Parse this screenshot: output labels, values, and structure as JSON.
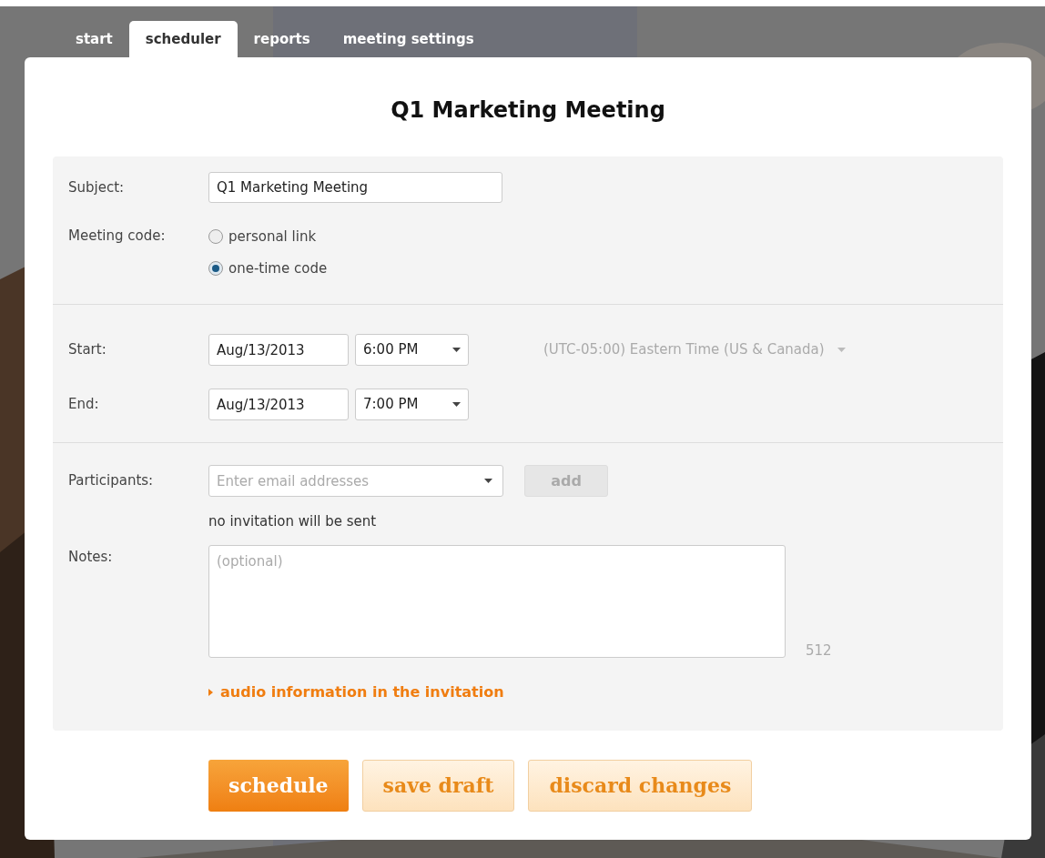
{
  "tabs": [
    {
      "label": "start",
      "selected": false
    },
    {
      "label": "scheduler",
      "selected": true
    },
    {
      "label": "reports",
      "selected": false
    },
    {
      "label": "meeting settings",
      "selected": false
    }
  ],
  "title": "Q1 Marketing Meeting",
  "subject": {
    "label": "Subject:",
    "value": "Q1 Marketing Meeting"
  },
  "meeting_code": {
    "label": "Meeting code:",
    "options": [
      {
        "label": "personal link",
        "selected": false
      },
      {
        "label": "one-time code",
        "selected": true
      }
    ]
  },
  "start": {
    "label": "Start:",
    "date": "Aug/13/2013",
    "time": "6:00 PM",
    "timezone": "(UTC-05:00) Eastern Time (US & Canada)"
  },
  "end": {
    "label": "End:",
    "date": "Aug/13/2013",
    "time": "7:00 PM"
  },
  "participants": {
    "label": "Participants:",
    "placeholder": "Enter email addresses",
    "add_button": {
      "label": "add",
      "disabled": true
    },
    "note": "no invitation will be sent"
  },
  "notes": {
    "label": "Notes:",
    "placeholder": "(optional)",
    "counter": "512"
  },
  "audio_link": {
    "label": "audio information in the invitation",
    "expanded": false
  },
  "buttons": [
    {
      "label": "schedule",
      "kind": "primary"
    },
    {
      "label": "save draft",
      "kind": "secondary"
    },
    {
      "label": "discard changes",
      "kind": "secondary"
    }
  ]
}
